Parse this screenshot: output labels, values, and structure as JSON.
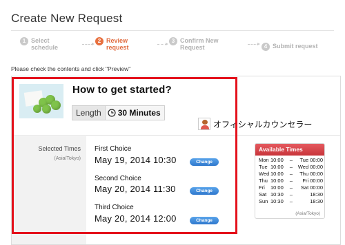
{
  "page": {
    "title": "Create New Request"
  },
  "steps": [
    {
      "num": "1",
      "label_line1": "Select",
      "label_line2": "schedule",
      "active": false
    },
    {
      "num": "2",
      "label_line1": "Review",
      "label_line2": "request",
      "active": true
    },
    {
      "num": "3",
      "label_line1": "Confirm New",
      "label_line2": "Request",
      "active": false
    },
    {
      "num": "4",
      "label_line1": "Submit request",
      "label_line2": "",
      "active": false
    }
  ],
  "instruction": "Please check the contents and click \"Preview\"",
  "topic": {
    "title": "How to get started?",
    "length_label": "Length",
    "length_value": "30 Minutes",
    "counselor": "オフィシャルカウンセラー"
  },
  "selected_times": {
    "label": "Selected Times",
    "timezone": "(Asia/Tokyo)",
    "change_label": "Change",
    "choices": [
      {
        "heading": "First Choice",
        "datetime": "May 19, 2014 10:30"
      },
      {
        "heading": "Second Choice",
        "datetime": "May 20, 2014 11:30"
      },
      {
        "heading": "Third Choice",
        "datetime": "May 20, 2014 12:00"
      }
    ]
  },
  "available_times": {
    "title": "Available Times",
    "timezone": "(Asia/Tokyo)",
    "rows": [
      {
        "day": "Mon",
        "from": "10:00",
        "sep": "–",
        "to": "Tue 00:00"
      },
      {
        "day": "Tue",
        "from": "10:00",
        "sep": "–",
        "to": "Wed 00:00"
      },
      {
        "day": "Wed",
        "from": "10:00",
        "sep": "–",
        "to": "Thu 00:00"
      },
      {
        "day": "Thu",
        "from": "10:00",
        "sep": "–",
        "to": "Fri 00:00"
      },
      {
        "day": "Fri",
        "from": "10:00",
        "sep": "–",
        "to": "Sat 00:00"
      },
      {
        "day": "Sat",
        "from": "10:30",
        "sep": "–",
        "to": "18:30"
      },
      {
        "day": "Sun",
        "from": "10:30",
        "sep": "–",
        "to": "18:30"
      }
    ]
  },
  "colors": {
    "active_step": "#e8703f",
    "change_button": "#2f78cd",
    "available_header": "#c8343a",
    "highlight": "#e4111b"
  },
  "icons": {
    "length": "clock-icon",
    "counselor": "counselor-avatar-icon"
  }
}
